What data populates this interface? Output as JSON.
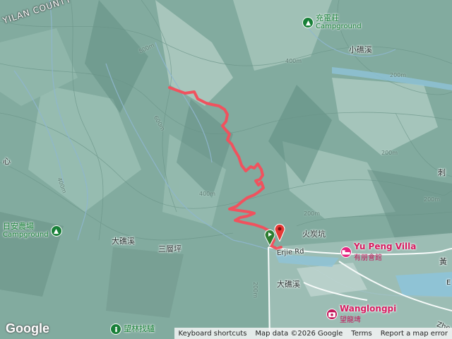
{
  "map": {
    "labels": {
      "county": "YILAN COUNTY",
      "xiaotan": "小礁溪",
      "datan_left": "大礁溪",
      "sanceng": "三層坪",
      "huotan": "火炭坑",
      "datan_right": "大礁溪",
      "erjie": "Erjie Rd",
      "xin": "心",
      "ci": "刺",
      "huang": "黃",
      "zhe": "Zhe",
      "e": "E"
    },
    "elevations": [
      "800m",
      "400m",
      "200m",
      "600m",
      "400m",
      "400m",
      "200m",
      "200m",
      "200m",
      "200m"
    ],
    "pois": {
      "chongdian": {
        "name": "充電莊",
        "sub": "Campground",
        "icon": "campground-icon"
      },
      "rian": {
        "name": "日安農場",
        "sub": "Campground",
        "icon": "campground-icon"
      },
      "wanglin": {
        "name": "望林找驢",
        "icon": "person-icon"
      },
      "yupeng": {
        "name": "Yu Peng Villa",
        "sub": "有朋會館",
        "icon": "bed-icon"
      },
      "wanglongpi": {
        "name": "Wanglongpi",
        "sub": "望龍埤",
        "icon": "camera-icon"
      }
    },
    "track": {
      "color": "#f0525e",
      "start_marker": "start-flag-icon",
      "end_marker": "end-pin-icon"
    },
    "attribution": {
      "logo": "Google",
      "shortcuts": "Keyboard shortcuts",
      "data": "Map data ©2026 Google",
      "terms": "Terms",
      "report": "Report a map error"
    }
  }
}
